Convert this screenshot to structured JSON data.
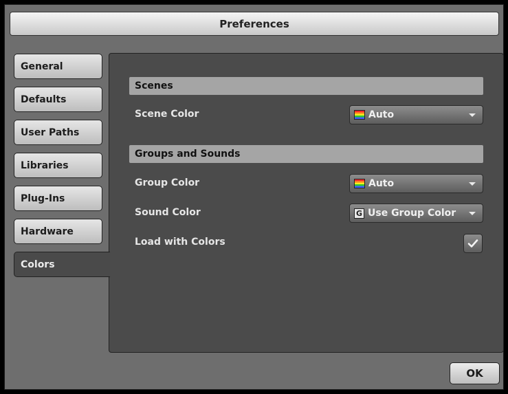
{
  "window": {
    "title": "Preferences"
  },
  "sidebar": {
    "tabs": [
      {
        "label": "General"
      },
      {
        "label": "Defaults"
      },
      {
        "label": "User Paths"
      },
      {
        "label": "Libraries"
      },
      {
        "label": "Plug-Ins"
      },
      {
        "label": "Hardware"
      },
      {
        "label": "Colors",
        "active": true
      }
    ]
  },
  "scenes": {
    "header": "Scenes",
    "scene_color": {
      "label": "Scene Color",
      "value": "Auto",
      "icon": "rainbow-icon"
    }
  },
  "groups_and_sounds": {
    "header": "Groups and Sounds",
    "group_color": {
      "label": "Group Color",
      "value": "Auto",
      "icon": "rainbow-icon"
    },
    "sound_color": {
      "label": "Sound Color",
      "value": "Use Group Color",
      "icon": "group-color-icon",
      "icon_glyph": "G"
    },
    "load_with_colors": {
      "label": "Load with Colors",
      "checked": true
    }
  },
  "footer": {
    "ok_label": "OK"
  },
  "colors": {
    "window_bg": "#6e6e6e",
    "panel_bg": "#4b4b4b",
    "section_header_bg": "#a5a5a5",
    "text_light": "#e6e6e6"
  }
}
